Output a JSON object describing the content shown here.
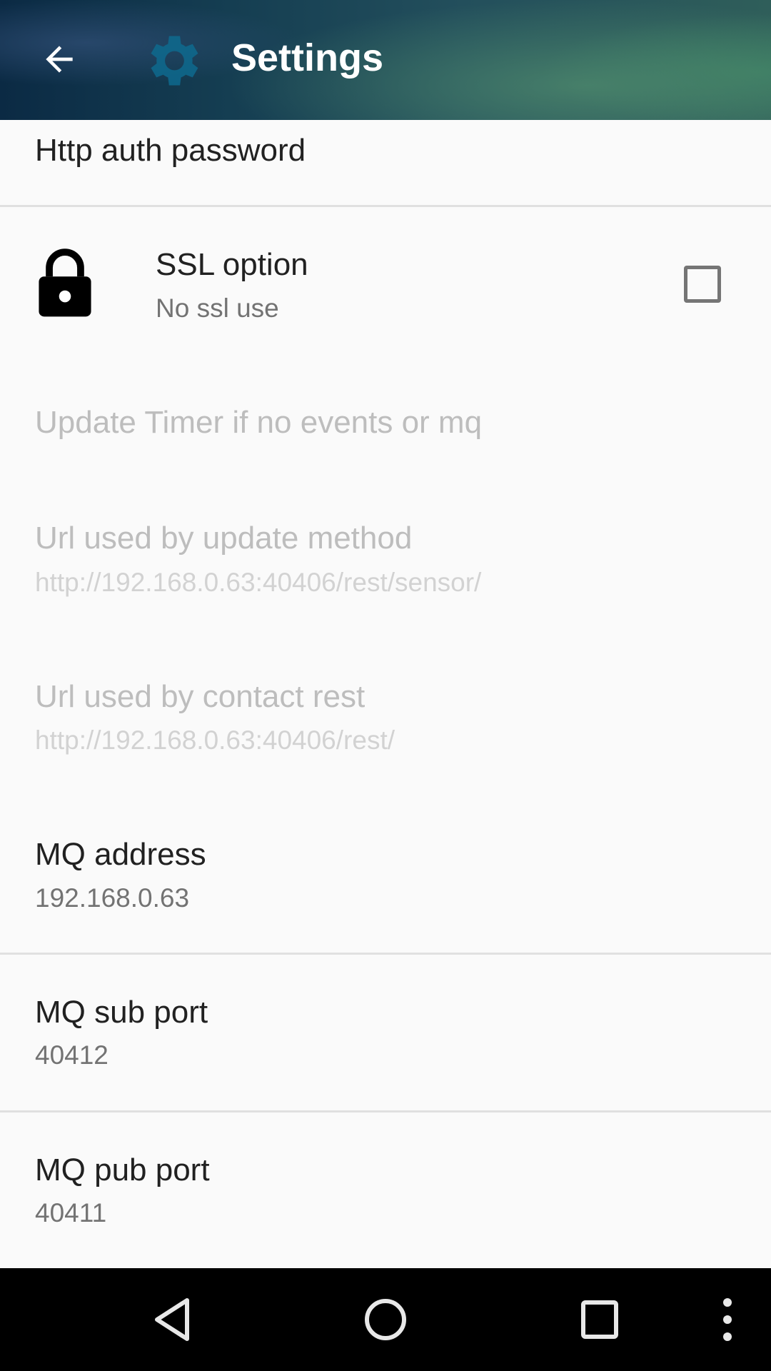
{
  "header": {
    "title": "Settings",
    "back_icon": "arrow-back-icon",
    "app_icon": "gear-icon"
  },
  "prefs": [
    {
      "title": "Http auth password"
    },
    {
      "title": "SSL option",
      "summary": "No ssl use",
      "icon": "lock-icon",
      "checked": false
    },
    {
      "title": "Update Timer if no events or mq",
      "enabled": false
    },
    {
      "title": "Url used by update method",
      "summary": "http://192.168.0.63:40406/rest/sensor/",
      "enabled": false
    },
    {
      "title": "Url used by contact rest",
      "summary": "http://192.168.0.63:40406/rest/",
      "enabled": false
    },
    {
      "title": "MQ address",
      "summary": "192.168.0.63"
    },
    {
      "title": "MQ sub port",
      "summary": "40412"
    },
    {
      "title": "MQ pub port",
      "summary": "40411"
    }
  ],
  "navbar": {
    "icons": [
      "back-triangle-icon",
      "home-circle-icon",
      "recents-square-icon",
      "overflow-menu-icon"
    ]
  }
}
